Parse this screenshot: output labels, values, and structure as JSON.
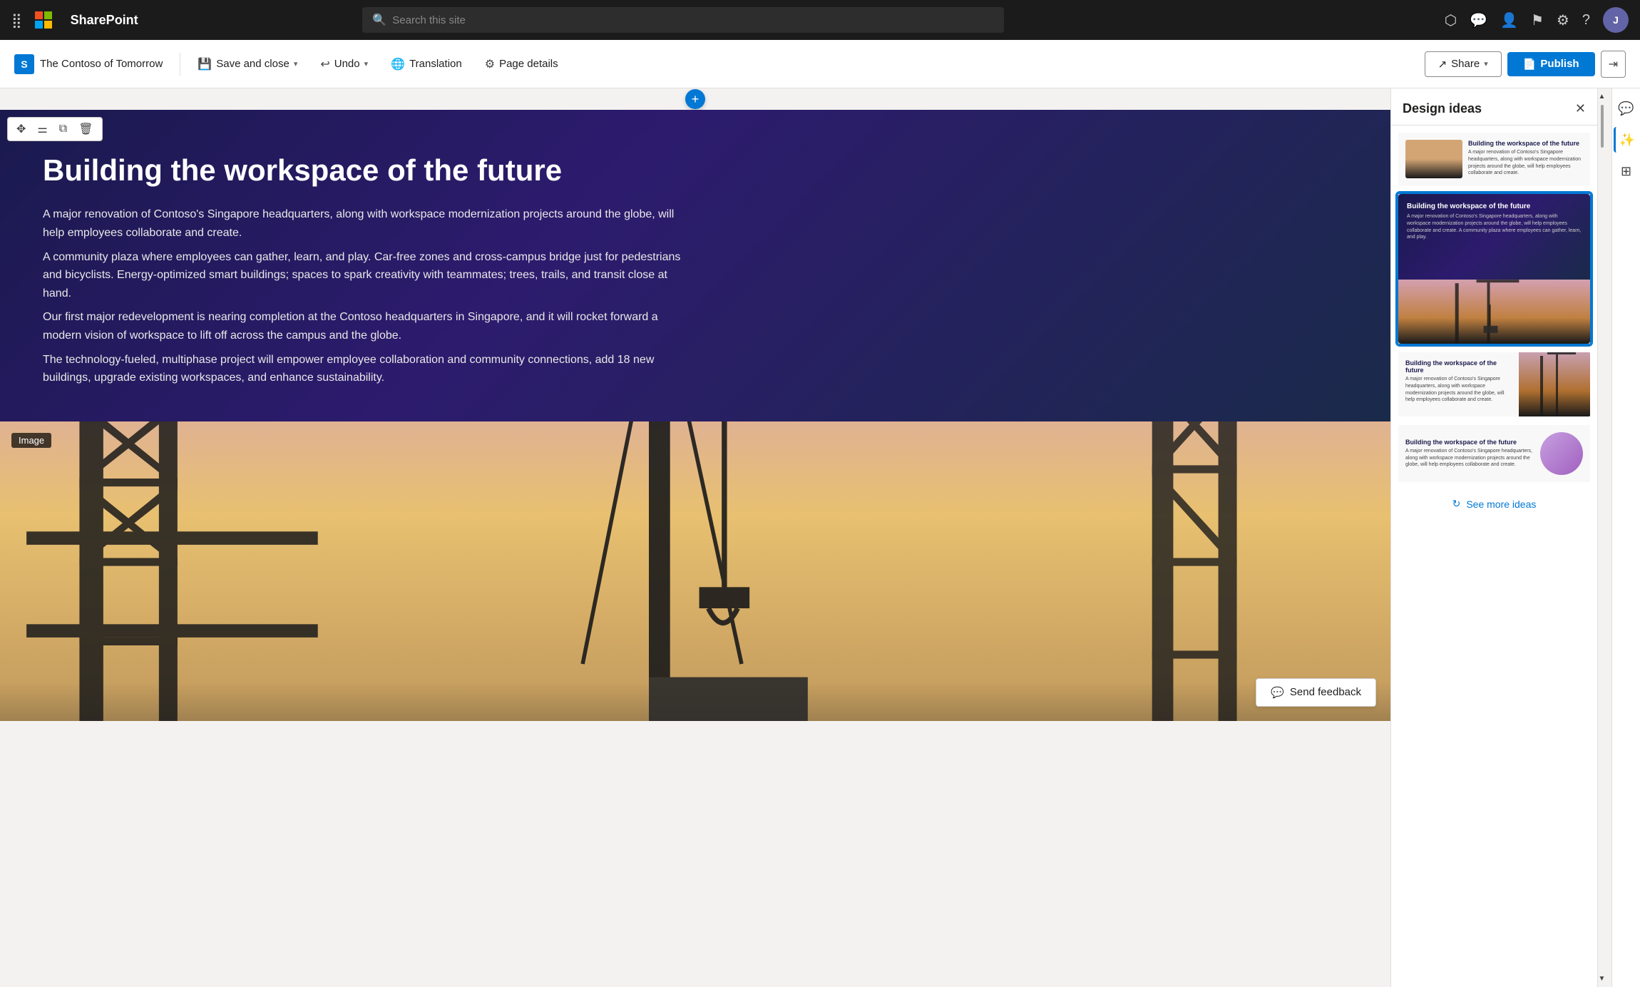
{
  "app": {
    "name": "SharePoint",
    "search_placeholder": "Search this site"
  },
  "toolbar": {
    "doc_title": "The Contoso of Tomorrow",
    "save_close_label": "Save and close",
    "undo_label": "Undo",
    "translation_label": "Translation",
    "page_details_label": "Page details",
    "share_label": "Share",
    "publish_label": "Publish"
  },
  "content": {
    "hero_title": "Building the workspace of the future",
    "hero_body_1": "A major renovation of Contoso's Singapore headquarters, along with workspace modernization projects around the globe, will help employees collaborate and create.",
    "hero_body_2": "A community plaza where employees can gather, learn, and play. Car-free zones and cross-campus bridge just for pedestrians and bicyclists. Energy-optimized smart buildings; spaces to spark creativity with teammates; trees, trails, and transit close at hand.",
    "hero_body_3": "Our first major redevelopment is nearing completion at the Contoso headquarters in Singapore, and it will rocket forward a modern vision of workspace to lift off across the campus and the globe.",
    "hero_body_4": "The technology-fueled, multiphase project will empower employee collaboration and community connections, add 18 new buildings, upgrade existing workspaces, and enhance sustainability.",
    "image_label": "Image",
    "send_feedback_label": "Send feedback"
  },
  "design_panel": {
    "title": "Design ideas",
    "see_more_label": "See more ideas",
    "card1": {
      "title": "Building the workspace of the future",
      "body": "A major renovation of Contoso's Singapore headquarters, along with workspace modernization projects around the globe, will help employees collaborate and create."
    },
    "card2": {
      "title": "Building the workspace of the future",
      "body": "A major renovation of Contoso's Singapore headquarters, along with workspace modernization projects around the globe, will help employees collaborate and create. A community plaza where employees can gather, learn, and play."
    },
    "card3": {
      "title": "Building the workspace of the future",
      "body": "A major renovation of Contoso's Singapore headquarters, along with workspace modernization projects around the globe, will help employees collaborate and create."
    },
    "card4": {
      "title": "Building the workspace of the future",
      "body": "A major renovation of Contoso's Singapore headquarters, along with workspace modernization projects around the globe, will help employees collaborate and create."
    }
  }
}
